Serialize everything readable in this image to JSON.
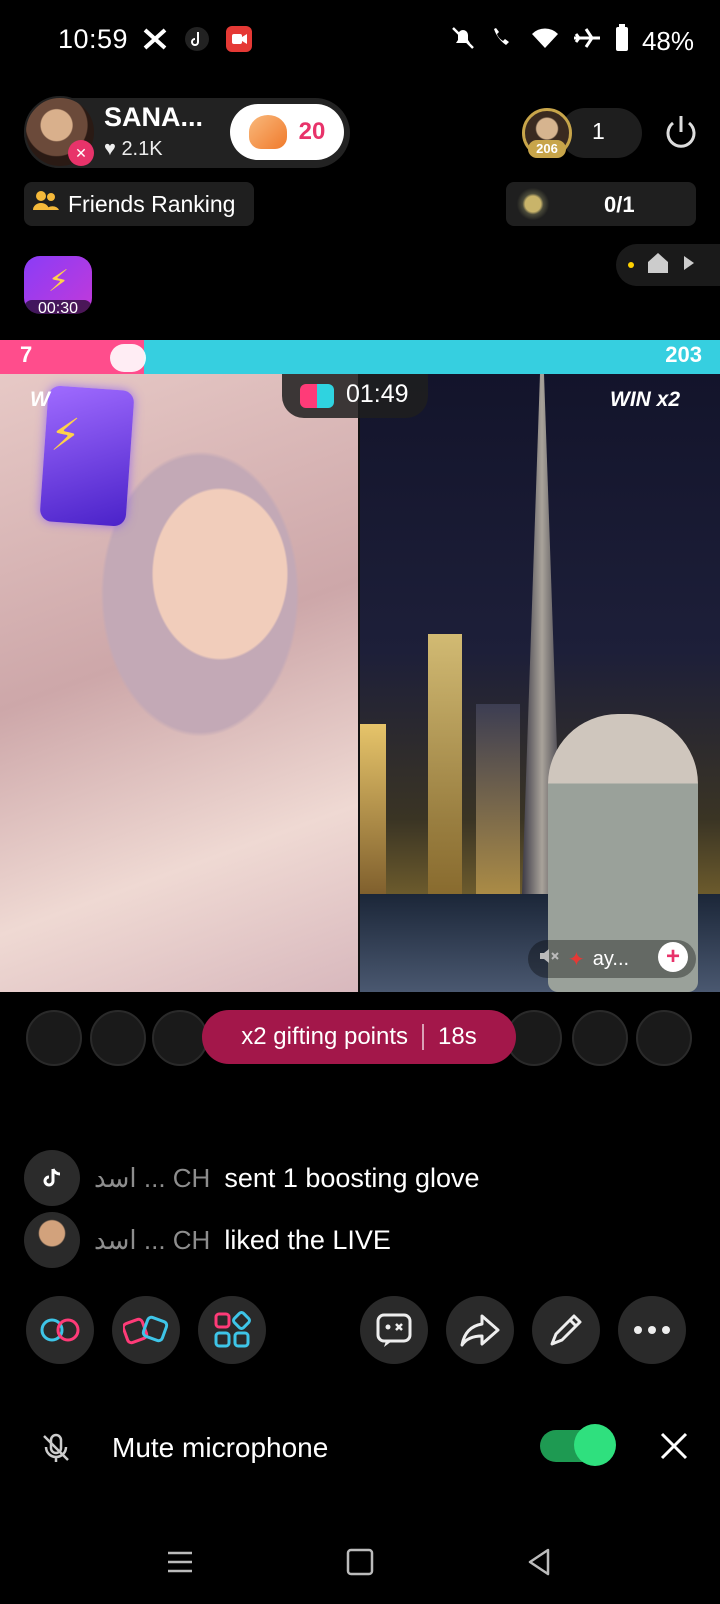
{
  "status_bar": {
    "time": "10:59",
    "battery": "48%",
    "icons_left": [
      "x-icon",
      "tiktok-icon",
      "video-record-icon"
    ],
    "icons_right": [
      "bell-off-icon",
      "wifi-calling-icon",
      "wifi-icon",
      "airplane-icon",
      "battery-icon"
    ]
  },
  "host": {
    "name": "SANA...",
    "likes": "2.1K",
    "follow_count": "20"
  },
  "viewers": {
    "badge": "206",
    "count": "1"
  },
  "friends_ranking": {
    "label": "Friends Ranking"
  },
  "ranking_progress": "0/1",
  "boost": {
    "timer": "00:30"
  },
  "battle": {
    "score_left": "7",
    "score_right": "203",
    "timer": "01:49",
    "win_right": "WIN x2",
    "win_left": "W",
    "guest_tag": "ay..."
  },
  "gifting": {
    "label": "x2 gifting points",
    "countdown": "18s"
  },
  "comments": [
    {
      "user": "اسد ... CH",
      "text": "sent 1 boosting glove"
    },
    {
      "user": "اسد ... CH",
      "text": "liked the LIVE"
    }
  ],
  "toolbar": [
    "link-icon",
    "match-icon",
    "apps-icon",
    "emoji-icon",
    "share-icon",
    "edit-icon",
    "more-icon"
  ],
  "mute": {
    "label": "Mute microphone",
    "enabled": true
  },
  "colors": {
    "accent_pink": "#e8336a",
    "score_left": "#ff4d8c",
    "score_right": "#36cfe0",
    "gift_banner": "#a3174a",
    "toggle_on": "#2fe07e"
  }
}
